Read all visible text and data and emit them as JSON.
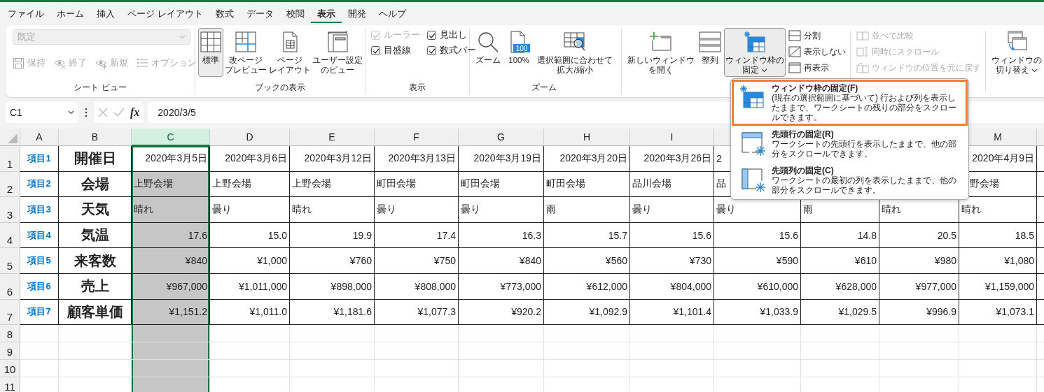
{
  "menu_tabs": [
    {
      "label": "ファイル",
      "selected": false
    },
    {
      "label": "ホーム",
      "selected": false
    },
    {
      "label": "挿入",
      "selected": false
    },
    {
      "label": "ページ レイアウト",
      "selected": false
    },
    {
      "label": "数式",
      "selected": false
    },
    {
      "label": "データ",
      "selected": false
    },
    {
      "label": "校閲",
      "selected": false
    },
    {
      "label": "表示",
      "selected": true
    },
    {
      "label": "開発",
      "selected": false
    },
    {
      "label": "ヘルプ",
      "selected": false
    }
  ],
  "ribbon": {
    "groups": [
      {
        "kind": "sheetview",
        "label": "シート ビュー",
        "view_select": {
          "value": "既定",
          "disabled": true
        },
        "buttons": [
          {
            "label": "保持",
            "disabled": true
          },
          {
            "label": "終了",
            "disabled": true
          },
          {
            "label": "新規",
            "disabled": true
          },
          {
            "label": "オプション",
            "disabled": true
          }
        ]
      },
      {
        "kind": "large",
        "label": "ブックの表示",
        "buttons": [
          {
            "lines": [
              "標準"
            ],
            "selected": true
          },
          {
            "lines": [
              "改ページ",
              "プレビュー"
            ],
            "selected": false
          },
          {
            "lines": [
              "ページ",
              "レイアウト"
            ],
            "selected": false
          },
          {
            "lines": [
              "ユーザー設定",
              "のビュー"
            ],
            "selected": false
          }
        ]
      },
      {
        "kind": "checks",
        "label": "表示",
        "checkboxes": [
          {
            "label": "ルーラー",
            "checked": true,
            "disabled": true
          },
          {
            "label": "見出し",
            "checked": true,
            "disabled": false
          },
          {
            "label": "目盛線",
            "checked": true,
            "disabled": false
          },
          {
            "label": "数式バー",
            "checked": true,
            "disabled": false
          }
        ]
      },
      {
        "kind": "zoom",
        "label": "ズーム",
        "icon_text": "100",
        "buttons": [
          {
            "lines": [
              "ズーム"
            ]
          },
          {
            "lines": [
              "100%"
            ]
          },
          {
            "lines": [
              "選択範囲に合わせて",
              "拡大/縮小"
            ]
          }
        ]
      },
      {
        "kind": "window",
        "buttons": [
          {
            "lines": [
              "新しいウィンドウ",
              "を開く"
            ],
            "selected": false,
            "menu": false
          },
          {
            "lines": [
              "整列"
            ],
            "selected": false,
            "menu": false
          },
          {
            "lines": [
              "ウィンドウ枠の",
              "固定"
            ],
            "selected": true,
            "menu": true
          }
        ],
        "small_buttons": [
          {
            "label": "分割"
          },
          {
            "label": "表示しない"
          },
          {
            "label": "再表示"
          }
        ],
        "sync_buttons": [
          {
            "label": "並べて比較",
            "disabled": true
          },
          {
            "label": "同時にスクロール",
            "disabled": true
          },
          {
            "label": "ウィンドウの位置を元に戻す",
            "disabled": true
          }
        ],
        "switch_button": {
          "lines": [
            "ウィンドウの",
            "切り替え"
          ],
          "menu": true
        }
      }
    ]
  },
  "formula_bar": {
    "name_box": "C1",
    "fx_label": "fx",
    "value": "2020/3/5"
  },
  "sheet": {
    "columns": [
      {
        "letter": "A",
        "selected": false
      },
      {
        "letter": "B",
        "selected": false
      },
      {
        "letter": "C",
        "selected": true
      },
      {
        "letter": "D",
        "selected": false
      },
      {
        "letter": "E",
        "selected": false
      },
      {
        "letter": "F",
        "selected": false
      },
      {
        "letter": "G",
        "selected": false
      },
      {
        "letter": "H",
        "selected": false
      },
      {
        "letter": "I",
        "selected": false
      }
    ],
    "columns_right": [
      {
        "letter": "M",
        "selected": false
      }
    ],
    "rows": [
      {
        "number": "1",
        "kind": "date",
        "label": "項目1",
        "heading": "開催日",
        "values": [
          "2020年3月5日",
          "2020年3月6日",
          "2020年3月12日",
          "2020年3月13日",
          "2020年3月19日",
          "2020年3月20日",
          "2020年3月26日",
          "2"
        ],
        "values_right": [
          "2020年4月9日"
        ]
      },
      {
        "number": "2",
        "kind": "text",
        "label": "項目2",
        "heading": "会場",
        "values": [
          "上野会場",
          "上野会場",
          "上野会場",
          "町田会場",
          "町田会場",
          "町田会場",
          "品川会場",
          "品"
        ],
        "values_right": [
          "野会場"
        ]
      },
      {
        "number": "3",
        "kind": "text",
        "label": "項目3",
        "heading": "天気",
        "values": [
          "晴れ",
          "曇り",
          "晴れ",
          "曇り",
          "曇り",
          "雨",
          "曇り",
          "曇り",
          "雨",
          "晴れ",
          "晴れ"
        ]
      },
      {
        "number": "4",
        "kind": "number",
        "label": "項目4",
        "heading": "気温",
        "values": [
          "17.6",
          "15.0",
          "19.9",
          "17.4",
          "16.3",
          "15.7",
          "15.6",
          "15.6",
          "14.8",
          "20.5",
          "18.5"
        ]
      },
      {
        "number": "5",
        "kind": "number",
        "label": "項目5",
        "heading": "来客数",
        "values": [
          "¥840",
          "¥1,000",
          "¥760",
          "¥750",
          "¥840",
          "¥560",
          "¥730",
          "¥590",
          "¥610",
          "¥980",
          "¥1,080"
        ]
      },
      {
        "number": "6",
        "kind": "number",
        "label": "項目6",
        "heading": "売上",
        "values": [
          "¥967,000",
          "¥1,011,000",
          "¥898,000",
          "¥808,000",
          "¥773,000",
          "¥612,000",
          "¥804,000",
          "¥610,000",
          "¥628,000",
          "¥977,000",
          "¥1,159,000"
        ]
      },
      {
        "number": "7",
        "kind": "number",
        "label": "項目7",
        "heading": "顧客単価",
        "values": [
          "¥1,151.2",
          "¥1,011.0",
          "¥1,181.6",
          "¥1,077.3",
          "¥920.2",
          "¥1,092.9",
          "¥1,101.4",
          "¥1,033.9",
          "¥1,029.5",
          "¥996.9",
          "¥1,073.1"
        ]
      },
      {
        "number": "8",
        "kind": "empty"
      },
      {
        "number": "9",
        "kind": "empty"
      },
      {
        "number": "10",
        "kind": "empty"
      },
      {
        "number": "11",
        "kind": "empty"
      }
    ]
  },
  "freeze_menu": {
    "items": [
      {
        "title": "ウィンドウ枠の固定(F)",
        "description": "(現在の選択範囲に基づいて) 行および列を表示したままで、ワークシートの残りの部分をスクロールできます。",
        "selected": true
      },
      {
        "title": "先頭行の固定(R)",
        "description": "ワークシートの先頭行を表示したままで、他の部分をスクロールできます。",
        "selected": false
      },
      {
        "title": "先頭列の固定(C)",
        "description": "ワークシートの最初の列を表示したままで、他の部分をスクロールできます。",
        "selected": false
      }
    ]
  }
}
